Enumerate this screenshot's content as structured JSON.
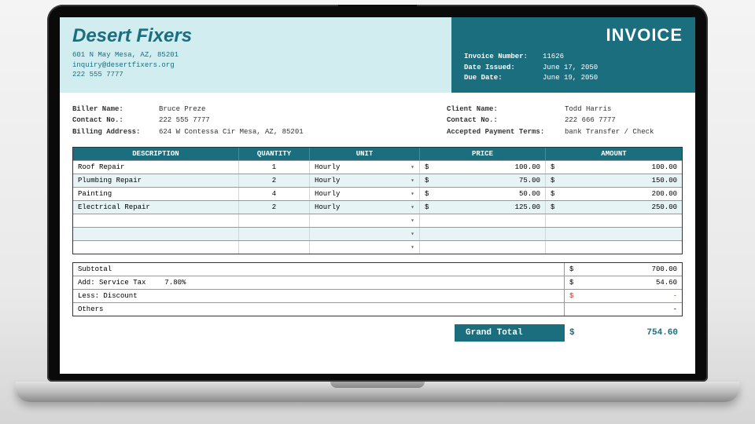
{
  "company": {
    "name": "Desert Fixers",
    "address": "601 N May Mesa, AZ, 85201",
    "email": "inquiry@desertfixers.org",
    "phone": "222 555 7777"
  },
  "invoice": {
    "title": "INVOICE",
    "number_label": "Invoice Number:",
    "number": "11626",
    "date_issued_label": "Date Issued:",
    "date_issued": "June 17, 2050",
    "due_date_label": "Due Date:",
    "due_date": "June 19, 2050"
  },
  "biller": {
    "name_label": "Biller Name:",
    "name": "Bruce Preze",
    "contact_label": "Contact No.:",
    "contact": "222 555 7777",
    "address_label": "Billing Address:",
    "address": "624 W Contessa Cir Mesa, AZ, 85201"
  },
  "client": {
    "name_label": "Client Name:",
    "name": "Todd Harris",
    "contact_label": "Contact No.:",
    "contact": "222 666 7777",
    "terms_label": "Accepted Payment Terms:",
    "terms": "bank Transfer / Check"
  },
  "columns": {
    "description": "DESCRIPTION",
    "quantity": "QUANTITY",
    "unit": "UNIT",
    "price": "PRICE",
    "amount": "AMOUNT"
  },
  "rows": [
    {
      "description": "Roof Repair",
      "quantity": "1",
      "unit": "Hourly",
      "price": "100.00",
      "amount": "100.00"
    },
    {
      "description": "Plumbing Repair",
      "quantity": "2",
      "unit": "Hourly",
      "price": "75.00",
      "amount": "150.00"
    },
    {
      "description": "Painting",
      "quantity": "4",
      "unit": "Hourly",
      "price": "50.00",
      "amount": "200.00"
    },
    {
      "description": "Electrical Repair",
      "quantity": "2",
      "unit": "Hourly",
      "price": "125.00",
      "amount": "250.00"
    },
    {
      "description": "",
      "quantity": "",
      "unit": "",
      "price": "",
      "amount": ""
    },
    {
      "description": "",
      "quantity": "",
      "unit": "",
      "price": "",
      "amount": ""
    },
    {
      "description": "",
      "quantity": "",
      "unit": "",
      "price": "",
      "amount": ""
    }
  ],
  "totals": {
    "subtotal_label": "Subtotal",
    "subtotal": "700.00",
    "tax_label": "Add: Service Tax",
    "tax_rate": "7.80%",
    "tax": "54.60",
    "discount_label": "Less: Discount",
    "discount": "-",
    "others_label": "Others",
    "others": "-",
    "currency": "$"
  },
  "grand": {
    "label": "Grand Total",
    "currency": "$",
    "value": "754.60"
  }
}
